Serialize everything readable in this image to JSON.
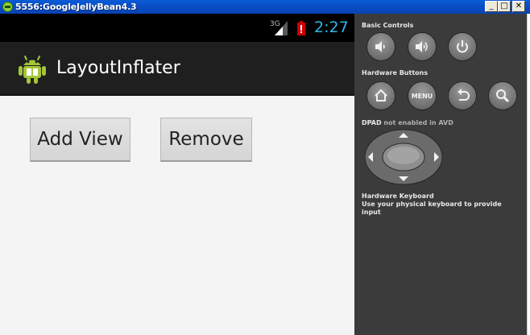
{
  "window": {
    "title": "5556:GoogleJellyBean4.3",
    "minimize_glyph": "_",
    "maximize_glyph": "□",
    "close_glyph": "✕"
  },
  "statusbar": {
    "network": "3G",
    "clock": "2:27"
  },
  "app": {
    "title": "LayoutInflater"
  },
  "buttons": {
    "add_view": "Add View",
    "remove": "Remove"
  },
  "controls": {
    "basic_controls_label": "Basic Controls",
    "hardware_buttons_label": "Hardware Buttons",
    "menu_label": "MENU",
    "dpad_label": "DPAD",
    "dpad_note": "not enabled in AVD",
    "keyboard_title": "Hardware Keyboard",
    "keyboard_hint": "Use your physical keyboard to provide input"
  },
  "colors": {
    "clock": "#33b5e5",
    "actionbar": "#1f1f1f",
    "panel": "#3b3b3b",
    "android_green": "#a4c639"
  }
}
